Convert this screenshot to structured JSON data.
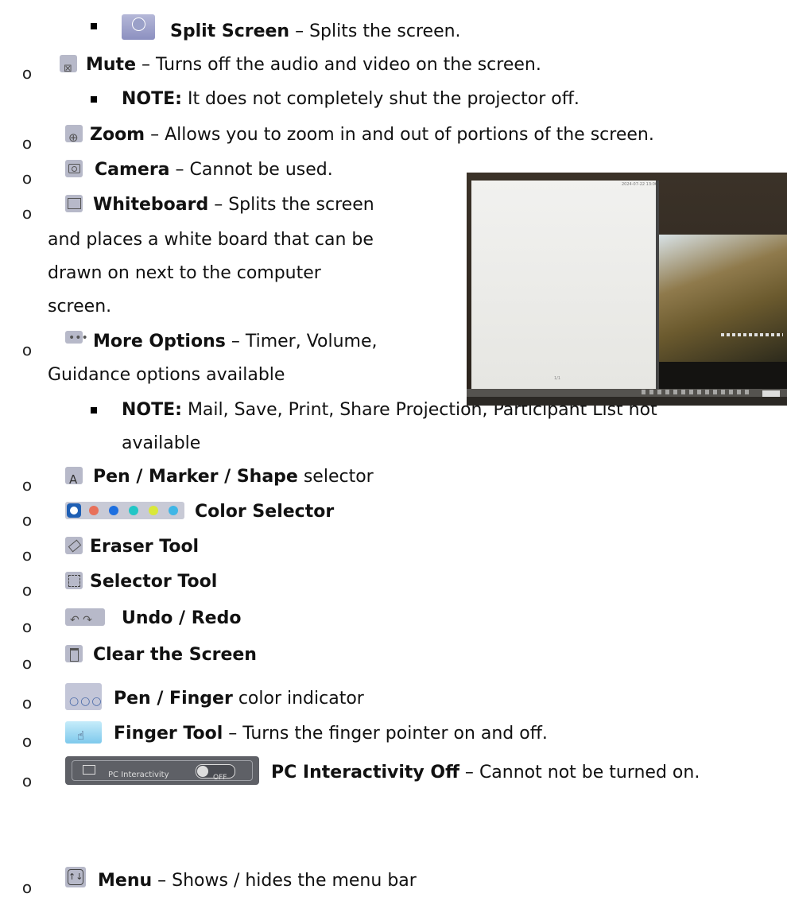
{
  "items": [
    {
      "title": "Split Screen",
      "sep": " – ",
      "desc": "Splits the screen."
    },
    {
      "title": "Mute",
      "sep": " – ",
      "desc": "Turns off the audio and video on the screen."
    },
    {
      "title": "NOTE:",
      "sep": " ",
      "desc": "It does not completely shut the projector off."
    },
    {
      "title": "Zoom",
      "sep": " – ",
      "desc": "Allows you to zoom in and out of portions of the screen."
    },
    {
      "title": "Camera",
      "sep": " – ",
      "desc": "Cannot be used."
    },
    {
      "title": "Whiteboard",
      "sep": " – ",
      "desc_lines": [
        "Splits the screen",
        "and places a white board that can be",
        "drawn on next to the computer",
        "screen."
      ]
    },
    {
      "title": "More Options",
      "sep": " – ",
      "desc_lines": [
        "Timer, Volume,",
        "Guidance options available"
      ]
    },
    {
      "title": "NOTE:",
      "sep": " ",
      "desc_lines": [
        "Mail, Save, Print, Share Projection, Participant List not",
        "available"
      ]
    },
    {
      "title": "Pen / Marker / Shape",
      "sep": " ",
      "desc": "selector"
    },
    {
      "title": "Color Selector"
    },
    {
      "title": "Eraser Tool"
    },
    {
      "title": "Selector Tool"
    },
    {
      "title": "Undo / Redo"
    },
    {
      "title": "Clear the Screen"
    },
    {
      "title": "Pen / Finger",
      "sep": " ",
      "desc": "color indicator"
    },
    {
      "title": "Finger Tool",
      "sep": " – ",
      "desc": "Turns the finger pointer on and off."
    },
    {
      "title": "PC Interactivity Off",
      "sep": " – ",
      "desc": "Cannot not be turned on."
    },
    {
      "title": "Menu",
      "sep": " – ",
      "desc": "Shows / hides the menu bar"
    }
  ],
  "icon_labels": {
    "split_screen": "Split Screen",
    "pc_interactivity": "PC Interactivity",
    "off": "OFF"
  },
  "photo": {
    "timestamp": "2024-07-22 13:06",
    "pager": "1/1"
  },
  "icons": [
    "split-screen-icon",
    "mute-icon",
    "zoom-icon",
    "camera-icon",
    "whiteboard-icon",
    "more-options-icon",
    "pen-icon",
    "color-swatches",
    "eraser-icon",
    "selector-icon",
    "undo-redo-icon",
    "trash-icon",
    "pen-finger-icon",
    "finger-icon",
    "pc-interactivity-toggle",
    "menu-icon"
  ],
  "colors": {
    "swatches": [
      "#1e5fb4",
      "#e8705a",
      "#1d6fe0",
      "#22c6c6",
      "#d9e83a",
      "#3fb6e6"
    ]
  }
}
